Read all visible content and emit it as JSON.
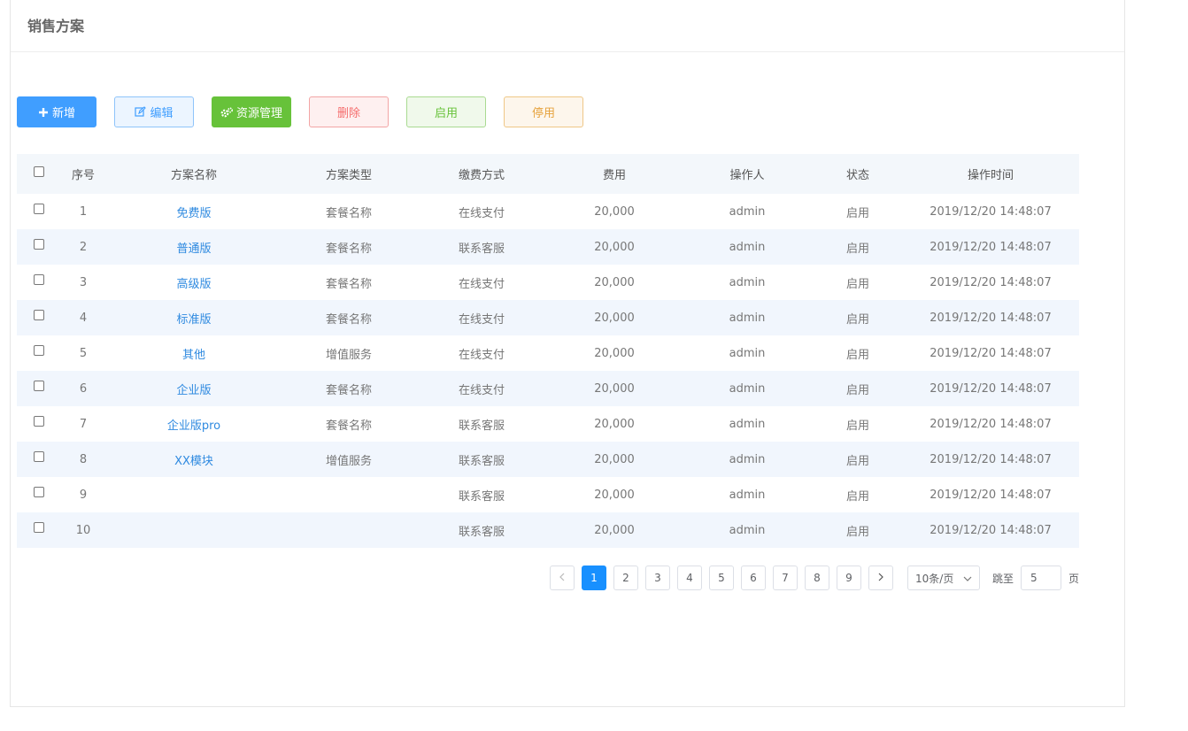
{
  "panel": {
    "title": "销售方案"
  },
  "toolbar": {
    "add_label": "新增",
    "edit_label": "编辑",
    "resource_label": "资源管理",
    "delete_label": "删除",
    "enable_label": "启用",
    "disable_label": "停用"
  },
  "table": {
    "headers": {
      "index": "序号",
      "name": "方案名称",
      "type": "方案类型",
      "payment": "缴费方式",
      "fee": "费用",
      "operator": "操作人",
      "status": "状态",
      "time": "操作时间"
    },
    "rows": [
      {
        "index": "1",
        "name": "免费版",
        "type": "套餐名称",
        "payment": "在线支付",
        "fee": "20,000",
        "operator": "admin",
        "status": "启用",
        "time": "2019/12/20 14:48:07"
      },
      {
        "index": "2",
        "name": "普通版",
        "type": "套餐名称",
        "payment": "联系客服",
        "fee": "20,000",
        "operator": "admin",
        "status": "启用",
        "time": "2019/12/20 14:48:07"
      },
      {
        "index": "3",
        "name": "高级版",
        "type": "套餐名称",
        "payment": "在线支付",
        "fee": "20,000",
        "operator": "admin",
        "status": "启用",
        "time": "2019/12/20 14:48:07"
      },
      {
        "index": "4",
        "name": "标准版",
        "type": "套餐名称",
        "payment": "在线支付",
        "fee": "20,000",
        "operator": "admin",
        "status": "启用",
        "time": "2019/12/20 14:48:07"
      },
      {
        "index": "5",
        "name": "其他",
        "type": "增值服务",
        "payment": "在线支付",
        "fee": "20,000",
        "operator": "admin",
        "status": "启用",
        "time": "2019/12/20 14:48:07"
      },
      {
        "index": "6",
        "name": "企业版",
        "type": "套餐名称",
        "payment": "在线支付",
        "fee": "20,000",
        "operator": "admin",
        "status": "启用",
        "time": "2019/12/20 14:48:07"
      },
      {
        "index": "7",
        "name": "企业版pro",
        "type": "套餐名称",
        "payment": "联系客服",
        "fee": "20,000",
        "operator": "admin",
        "status": "启用",
        "time": "2019/12/20 14:48:07"
      },
      {
        "index": "8",
        "name": "XX模块",
        "type": "增值服务",
        "payment": "联系客服",
        "fee": "20,000",
        "operator": "admin",
        "status": "启用",
        "time": "2019/12/20 14:48:07"
      },
      {
        "index": "9",
        "name": "",
        "type": "",
        "payment": "联系客服",
        "fee": "20,000",
        "operator": "admin",
        "status": "启用",
        "time": "2019/12/20 14:48:07"
      },
      {
        "index": "10",
        "name": "",
        "type": "",
        "payment": "联系客服",
        "fee": "20,000",
        "operator": "admin",
        "status": "启用",
        "time": "2019/12/20 14:48:07"
      }
    ]
  },
  "pagination": {
    "prev_icon": "chevron-left-icon",
    "next_icon": "chevron-right-icon",
    "pages": [
      "1",
      "2",
      "3",
      "4",
      "5",
      "6",
      "7",
      "8",
      "9"
    ],
    "current": "1",
    "page_size": "10条/页",
    "jump_label": "跳至",
    "jump_value": "5",
    "page_label": "页"
  },
  "colors": {
    "primary": "#409eff",
    "success": "#67c23a",
    "danger": "#f56c6c",
    "warning": "#e6a23c",
    "link": "#2f8ae0"
  }
}
